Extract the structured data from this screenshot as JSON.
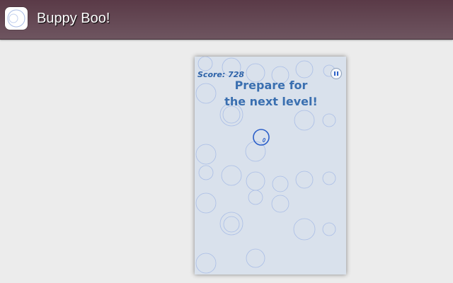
{
  "app": {
    "title": "Buppy Boo!",
    "icon": "bubble-icon"
  },
  "game": {
    "score_text": "Score: 728",
    "score": 728,
    "message": "Prepare for the next level!",
    "pause_icon": "pause-icon",
    "colors": {
      "background": "#d9e1ec",
      "bubble": "#a9bde6",
      "player": "#2b5fc9",
      "text": "#3a6fb0"
    }
  }
}
